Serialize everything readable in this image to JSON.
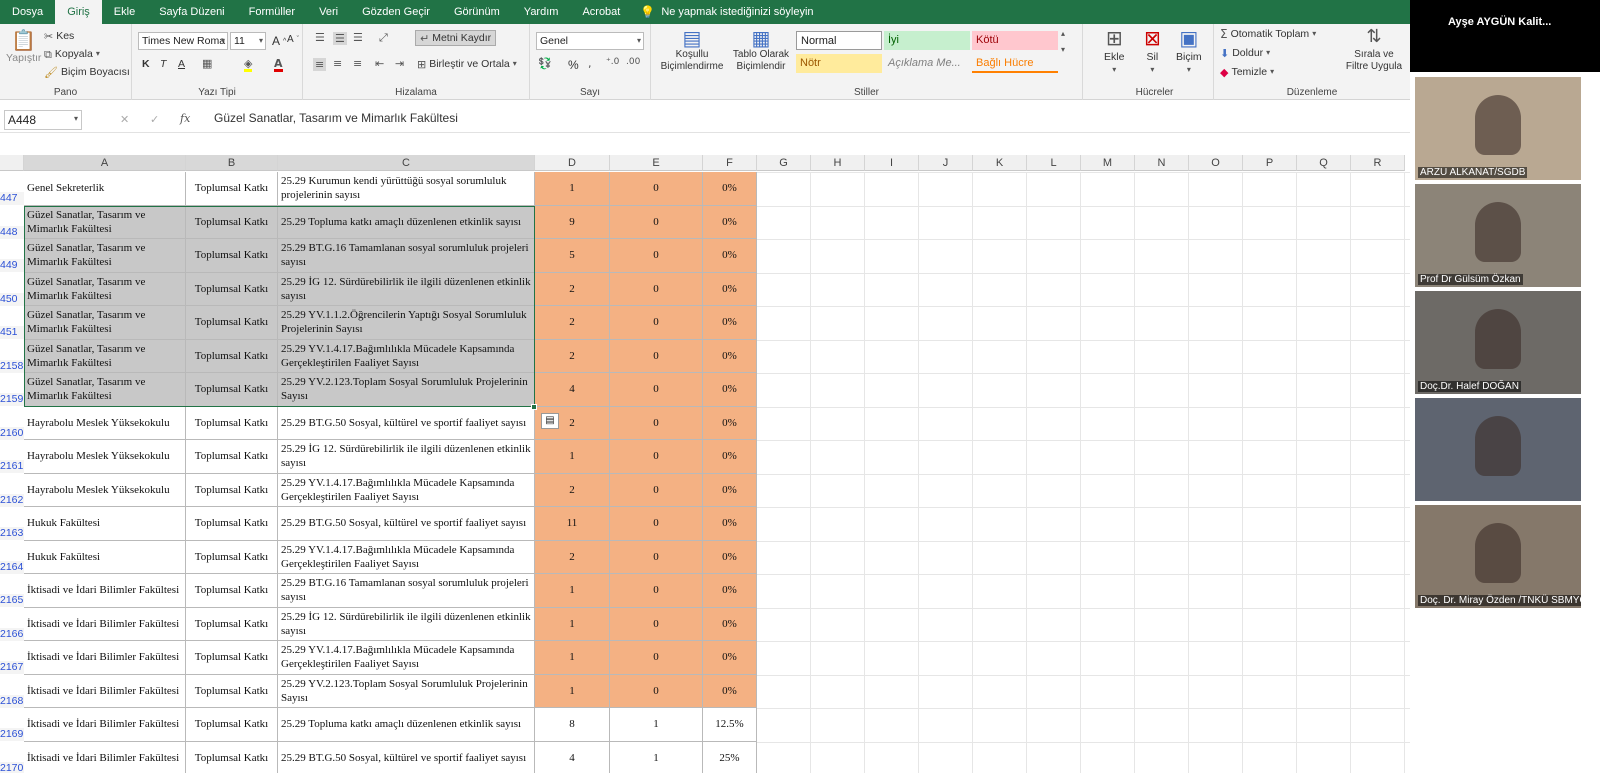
{
  "ribbon_tabs": [
    "Dosya",
    "Giriş",
    "Ekle",
    "Sayfa Düzeni",
    "Formüller",
    "Veri",
    "Gözden Geçir",
    "Görünüm",
    "Yardım",
    "Acrobat"
  ],
  "tell_me": "Ne yapmak istediğinizi söyleyin",
  "clipboard": {
    "paste": "Yapıştır",
    "cut": "Kes",
    "copy": "Kopyala",
    "painter": "Biçim Boyacısı",
    "label": "Pano"
  },
  "font": {
    "name": "Times New Roma",
    "size": "11",
    "bold": "K",
    "italic": "T",
    "underline": "A",
    "label": "Yazı Tipi"
  },
  "alignment": {
    "wrap": "Metni Kaydır",
    "merge": "Birleştir ve Ortala",
    "label": "Hizalama"
  },
  "number": {
    "format": "Genel",
    "percent": "%",
    "label": "Sayı"
  },
  "styles": {
    "conditional": "Koşullu Biçimlendirme",
    "table": "Tablo Olarak Biçimlendir",
    "normal": "Normal",
    "good": "İyi",
    "bad": "Kötü",
    "neutral": "Nötr",
    "explanatory": "Açıklama Me...",
    "linked": "Bağlı Hücre",
    "label": "Stiller"
  },
  "cells_group": {
    "insert": "Ekle",
    "delete": "Sil",
    "format": "Biçim",
    "label": "Hücreler"
  },
  "editing": {
    "autosum": "Otomatik Toplam",
    "fill": "Doldur",
    "clear": "Temizle",
    "sort": "Sırala ve Filtre Uygula",
    "label": "Düzenleme"
  },
  "namebox": "A448",
  "formula_value": "Güzel Sanatlar, Tasarım ve Mimarlık Fakültesi",
  "columns": [
    "A",
    "B",
    "C",
    "D",
    "E",
    "F",
    "G",
    "H",
    "I",
    "J",
    "K",
    "L",
    "M",
    "N",
    "O",
    "P",
    "Q",
    "R"
  ],
  "rows": [
    {
      "num": "447",
      "a": "Genel Sekreterlik",
      "b": "Toplumsal Katkı",
      "c": "25.29 Kurumun kendi yürüttüğü sosyal sorumluluk projelerinin sayısı",
      "d": "1",
      "e": "0",
      "f": "0%",
      "sel": false,
      "orange": true
    },
    {
      "num": "448",
      "a": "Güzel Sanatlar, Tasarım ve Mimarlık Fakültesi",
      "b": "Toplumsal Katkı",
      "c": "25.29 Topluma katkı amaçlı düzenlenen etkinlik sayısı",
      "d": "9",
      "e": "0",
      "f": "0%",
      "sel": true,
      "orange": true
    },
    {
      "num": "449",
      "a": "Güzel Sanatlar, Tasarım ve Mimarlık Fakültesi",
      "b": "Toplumsal Katkı",
      "c": "25.29 BT.G.16 Tamamlanan sosyal sorumluluk projeleri sayısı",
      "d": "5",
      "e": "0",
      "f": "0%",
      "sel": true,
      "orange": true
    },
    {
      "num": "450",
      "a": "Güzel Sanatlar, Tasarım ve Mimarlık Fakültesi",
      "b": "Toplumsal Katkı",
      "c": "25.29 İG 12. Sürdürebilirlik ile ilgili düzenlenen etkinlik sayısı",
      "d": "2",
      "e": "0",
      "f": "0%",
      "sel": true,
      "orange": true
    },
    {
      "num": "451",
      "a": "Güzel Sanatlar, Tasarım ve Mimarlık Fakültesi",
      "b": "Toplumsal Katkı",
      "c": "25.29 YV.1.1.2.Öğrencilerin Yaptığı Sosyal Sorumluluk Projelerinin Sayısı",
      "d": "2",
      "e": "0",
      "f": "0%",
      "sel": true,
      "orange": true
    },
    {
      "num": "2158",
      "a": "Güzel Sanatlar, Tasarım ve Mimarlık Fakültesi",
      "b": "Toplumsal Katkı",
      "c": "25.29 YV.1.4.17.Bağımlılıkla Mücadele Kapsamında Gerçekleştirilen Faaliyet Sayısı",
      "d": "2",
      "e": "0",
      "f": "0%",
      "sel": true,
      "orange": true
    },
    {
      "num": "2159",
      "a": "Güzel Sanatlar, Tasarım ve Mimarlık Fakültesi",
      "b": "Toplumsal Katkı",
      "c": "25.29 YV.2.123.Toplam Sosyal Sorumluluk Projelerinin Sayısı",
      "d": "4",
      "e": "0",
      "f": "0%",
      "sel": true,
      "orange": true
    },
    {
      "num": "2160",
      "a": "Hayrabolu Meslek Yüksekokulu",
      "b": "Toplumsal Katkı",
      "c": "25.29 BT.G.50 Sosyal, kültürel ve sportif faaliyet sayısı",
      "d": "2",
      "e": "0",
      "f": "0%",
      "sel": false,
      "orange": true
    },
    {
      "num": "2161",
      "a": "Hayrabolu Meslek Yüksekokulu",
      "b": "Toplumsal Katkı",
      "c": "25.29 İG 12. Sürdürebilirlik ile ilgili düzenlenen etkinlik sayısı",
      "d": "1",
      "e": "0",
      "f": "0%",
      "sel": false,
      "orange": true
    },
    {
      "num": "2162",
      "a": "Hayrabolu Meslek Yüksekokulu",
      "b": "Toplumsal Katkı",
      "c": "25.29 YV.1.4.17.Bağımlılıkla Mücadele Kapsamında Gerçekleştirilen Faaliyet Sayısı",
      "d": "2",
      "e": "0",
      "f": "0%",
      "sel": false,
      "orange": true
    },
    {
      "num": "2163",
      "a": "Hukuk Fakültesi",
      "b": "Toplumsal Katkı",
      "c": "25.29 BT.G.50 Sosyal, kültürel ve sportif faaliyet sayısı",
      "d": "11",
      "e": "0",
      "f": "0%",
      "sel": false,
      "orange": true
    },
    {
      "num": "2164",
      "a": "Hukuk Fakültesi",
      "b": "Toplumsal Katkı",
      "c": "25.29 YV.1.4.17.Bağımlılıkla Mücadele Kapsamında Gerçekleştirilen Faaliyet Sayısı",
      "d": "2",
      "e": "0",
      "f": "0%",
      "sel": false,
      "orange": true
    },
    {
      "num": "2165",
      "a": "İktisadi ve İdari Bilimler Fakültesi",
      "b": "Toplumsal Katkı",
      "c": "25.29 BT.G.16 Tamamlanan sosyal sorumluluk projeleri sayısı",
      "d": "1",
      "e": "0",
      "f": "0%",
      "sel": false,
      "orange": true
    },
    {
      "num": "2166",
      "a": "İktisadi ve İdari Bilimler Fakültesi",
      "b": "Toplumsal Katkı",
      "c": "25.29 İG 12. Sürdürebilirlik ile ilgili düzenlenen etkinlik sayısı",
      "d": "1",
      "e": "0",
      "f": "0%",
      "sel": false,
      "orange": true
    },
    {
      "num": "2167",
      "a": "İktisadi ve İdari Bilimler Fakültesi",
      "b": "Toplumsal Katkı",
      "c": "25.29 YV.1.4.17.Bağımlılıkla Mücadele Kapsamında Gerçekleştirilen Faaliyet Sayısı",
      "d": "1",
      "e": "0",
      "f": "0%",
      "sel": false,
      "orange": true
    },
    {
      "num": "2168",
      "a": "İktisadi ve İdari Bilimler Fakültesi",
      "b": "Toplumsal Katkı",
      "c": "25.29 YV.2.123.Toplam Sosyal Sorumluluk Projelerinin Sayısı",
      "d": "1",
      "e": "0",
      "f": "0%",
      "sel": false,
      "orange": true
    },
    {
      "num": "2169",
      "a": "İktisadi ve İdari Bilimler Fakültesi",
      "b": "Toplumsal Katkı",
      "c": "25.29 Topluma katkı amaçlı düzenlenen etkinlik sayısı",
      "d": "8",
      "e": "1",
      "f": "12.5%",
      "sel": false,
      "orange": false
    },
    {
      "num": "2170",
      "a": "İktisadi ve İdari Bilimler Fakültesi",
      "b": "Toplumsal Katkı",
      "c": "25.29 BT.G.50 Sosyal, kültürel ve sportif faaliyet sayısı",
      "d": "4",
      "e": "1",
      "f": "25%",
      "sel": false,
      "orange": false
    }
  ],
  "video_call": {
    "presenter": "Ayşe AYGÜN Kalit...",
    "participants": [
      "ARZU ALKANAT/SGDB",
      "Prof Dr Gülsüm Özkan",
      "Doç.Dr. Halef DOĞAN",
      "",
      "Doç. Dr. Miray Özden /TNKÜ SBMYO"
    ]
  },
  "colors": {
    "ribbon_green": "#217346",
    "selection_gray": "#c8c8c8",
    "orange_fill": "#f4b183",
    "good_bg": "#c6efce",
    "bad_bg": "#ffc7ce",
    "neutral_bg": "#ffeb9c"
  }
}
